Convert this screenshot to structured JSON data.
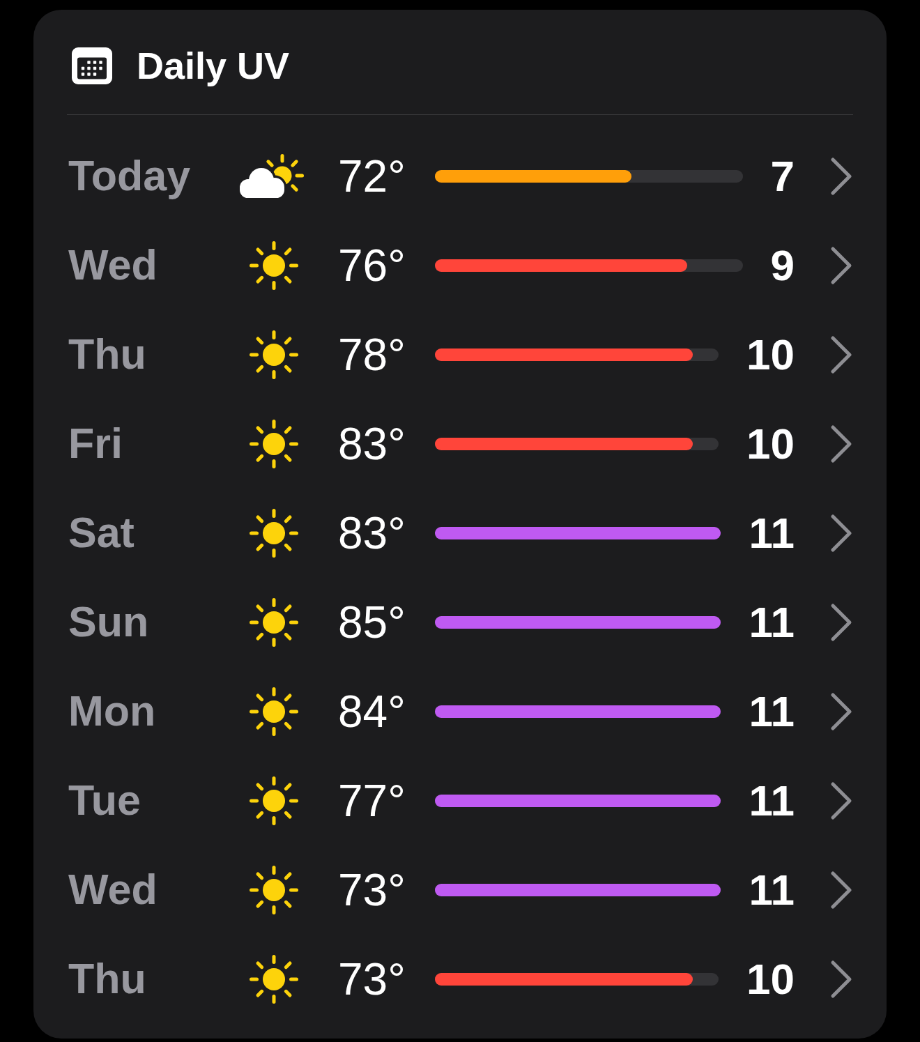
{
  "header": {
    "title": "Daily UV"
  },
  "days": [
    {
      "day": "Today",
      "kind": "partly-sunny",
      "temp": "72°",
      "level": 0.64,
      "color": "#ff9f0a",
      "uv": "7"
    },
    {
      "day": "Wed",
      "kind": "sunny",
      "temp": "76°",
      "level": 0.82,
      "color": "#ff453a",
      "uv": "9"
    },
    {
      "day": "Thu",
      "kind": "sunny",
      "temp": "78°",
      "level": 0.91,
      "color": "#ff453a",
      "uv": "10"
    },
    {
      "day": "Fri",
      "kind": "sunny",
      "temp": "83°",
      "level": 0.91,
      "color": "#ff453a",
      "uv": "10"
    },
    {
      "day": "Sat",
      "kind": "sunny",
      "temp": "83°",
      "level": 1,
      "color": "#bf5af2",
      "uv": "11"
    },
    {
      "day": "Sun",
      "kind": "sunny",
      "temp": "85°",
      "level": 1,
      "color": "#bf5af2",
      "uv": "11"
    },
    {
      "day": "Mon",
      "kind": "sunny",
      "temp": "84°",
      "level": 1,
      "color": "#bf5af2",
      "uv": "11"
    },
    {
      "day": "Tue",
      "kind": "sunny",
      "temp": "77°",
      "level": 1,
      "color": "#bf5af2",
      "uv": "11"
    },
    {
      "day": "Wed",
      "kind": "sunny",
      "temp": "73°",
      "level": 1,
      "color": "#bf5af2",
      "uv": "11"
    },
    {
      "day": "Thu",
      "kind": "sunny",
      "temp": "73°",
      "level": 0.91,
      "color": "#ff453a",
      "uv": "10"
    }
  ]
}
